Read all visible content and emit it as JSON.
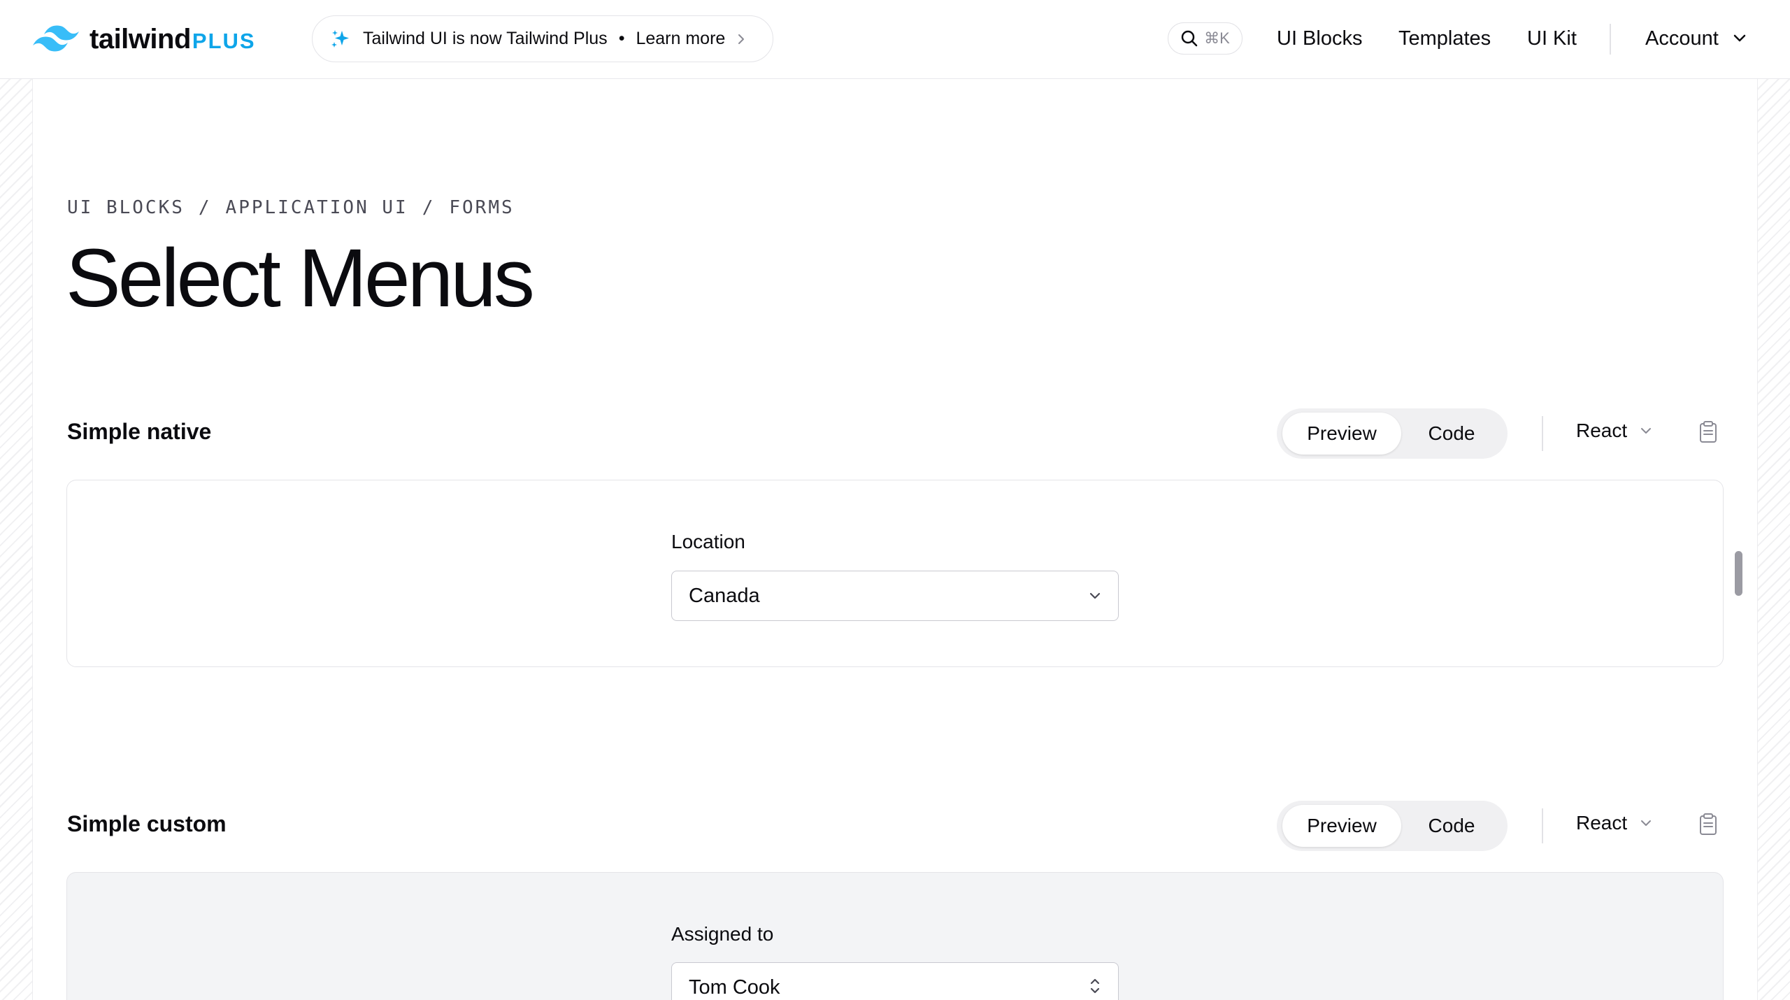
{
  "header": {
    "logo_word": "tailwind",
    "logo_plus": "PLUS",
    "announcement": {
      "message": "Tailwind UI is now Tailwind Plus",
      "separator": "•",
      "link": "Learn more"
    },
    "search_shortcut": "⌘K",
    "nav": [
      "UI Blocks",
      "Templates",
      "UI Kit"
    ],
    "account": "Account"
  },
  "breadcrumb": [
    "UI BLOCKS",
    "/",
    "APPLICATION UI",
    "/",
    "FORMS"
  ],
  "page_title": "Select Menus",
  "sections": [
    {
      "title": "Simple native",
      "toggle": {
        "preview": "Preview",
        "code": "Code",
        "active": "Preview"
      },
      "framework": "React",
      "field": {
        "label": "Location",
        "value": "Canada"
      }
    },
    {
      "title": "Simple custom",
      "toggle": {
        "preview": "Preview",
        "code": "Code",
        "active": "Preview"
      },
      "framework": "React",
      "field": {
        "label": "Assigned to",
        "value": "Tom Cook"
      }
    }
  ],
  "colors": {
    "brand": "#38bdf8",
    "brand_plus": "#0ea5e9",
    "text": "#0b0b0f",
    "border": "#e4e4e8",
    "preview_gray": "#f3f4f6"
  }
}
